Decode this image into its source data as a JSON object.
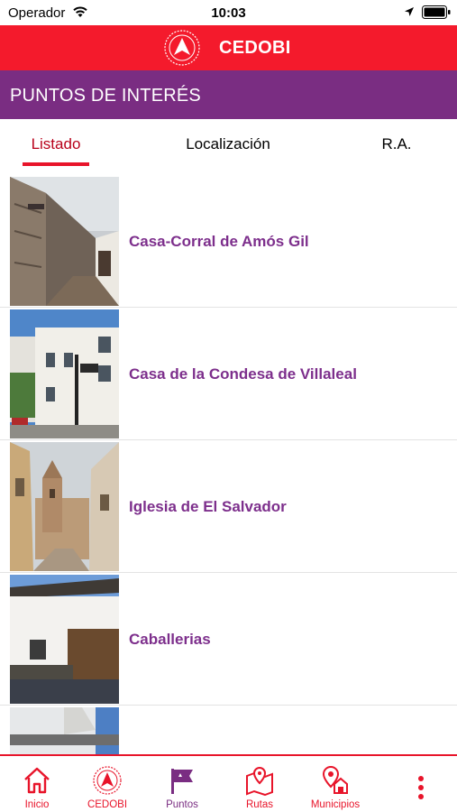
{
  "status_bar": {
    "carrier": "Operador",
    "time": "10:03",
    "icons": [
      "wifi-icon",
      "location-arrow-icon",
      "battery-icon"
    ]
  },
  "header": {
    "title": "CEDOBI",
    "logo": "cedobi-logo-icon"
  },
  "section": {
    "title": "PUNTOS DE INTERÉS"
  },
  "tabs": [
    {
      "label": "Listado",
      "active": true
    },
    {
      "label": "Localización",
      "active": false
    },
    {
      "label": "R.A.",
      "active": false
    }
  ],
  "points": [
    {
      "title": "Casa-Corral de Amós Gil",
      "image": "stone-wall-street-photo"
    },
    {
      "title": "Casa de la Condesa de Villaleal",
      "image": "white-building-street-photo"
    },
    {
      "title": "Iglesia de El Salvador",
      "image": "church-tower-street-photo"
    },
    {
      "title": "Caballerias",
      "image": "white-house-wooden-door-photo"
    },
    {
      "title": "",
      "image": "white-wall-photo"
    }
  ],
  "bottom_nav": [
    {
      "label": "Inicio",
      "icon": "home-icon",
      "active": false
    },
    {
      "label": "CEDOBI",
      "icon": "cedobi-logo-icon",
      "active": false
    },
    {
      "label": "Puntos",
      "icon": "flag-icon",
      "active": true
    },
    {
      "label": "Rutas",
      "icon": "map-pin-icon",
      "active": false
    },
    {
      "label": "Municipios",
      "icon": "town-pin-icon",
      "active": false
    },
    {
      "label": "",
      "icon": "more-vertical-icon",
      "active": false
    }
  ],
  "colors": {
    "header": "#f41a2c",
    "section": "#7a2d82",
    "item_title": "#7d2f8c",
    "active_tab": "#b8001a",
    "nav": "#e8142a"
  }
}
